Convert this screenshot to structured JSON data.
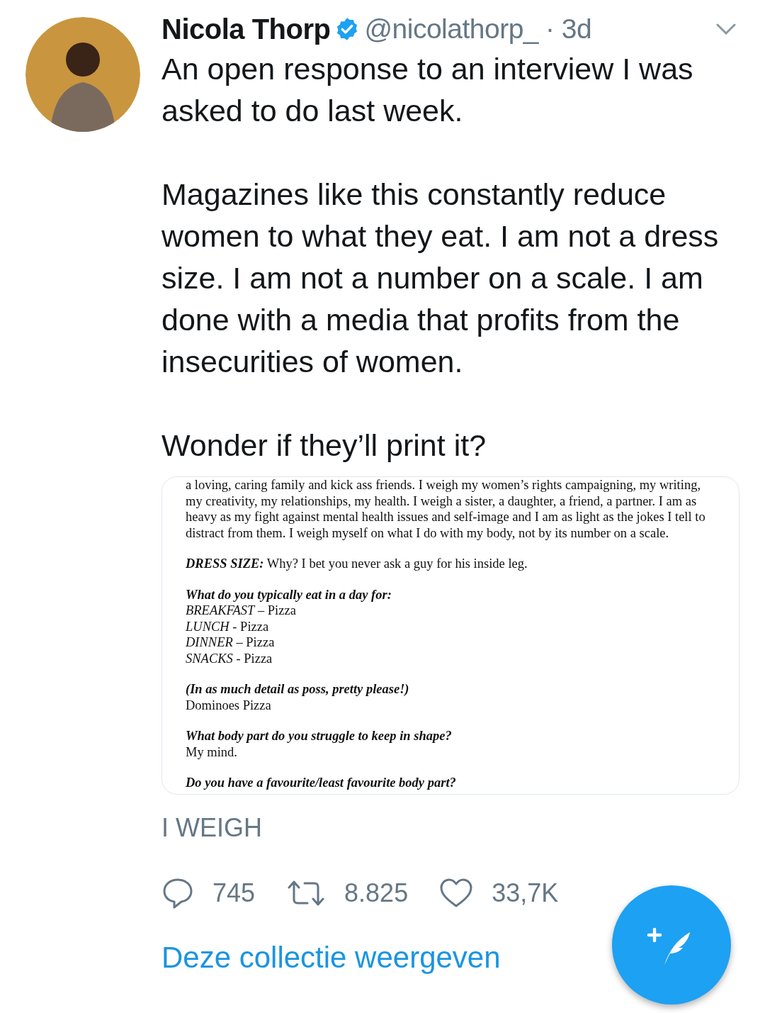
{
  "tweet": {
    "author": {
      "name": "Nicola Thorp",
      "verified": true,
      "handle": "@nicolathorp_",
      "time": "· 3d"
    },
    "paragraphs": [
      "An open response to an interview I was asked to do last week.",
      "Magazines like this constantly reduce women to what they eat. I am not a dress size. I am not a number on a scale. I am done with a media that profits from the insecurities of women.",
      "Wonder if they’ll print it?"
    ],
    "document": {
      "blocks": [
        {
          "lines": [
            {
              "kind": "plain",
              "text": "a loving, caring family and kick ass friends. I weigh my women’s rights campaigning, my writing, my creativity, my relationships, my health. I weigh a sister, a daughter, a friend, a partner. I am as heavy as my fight against mental health issues and self-image and I am as light as the jokes I tell to distract from them. I weigh myself on what I do with my body, not by its number on a scale."
            }
          ]
        },
        {
          "lines": [
            {
              "kind": "bold-label",
              "label": "DRESS SIZE:",
              "text": "Why? I bet you never ask a guy for his inside leg."
            }
          ]
        },
        {
          "lines": [
            {
              "kind": "question",
              "text": "What do you typically eat in a day for:"
            },
            {
              "kind": "italic-label",
              "label": "BREAKFAST",
              "text": "– Pizza"
            },
            {
              "kind": "italic-label",
              "label": "LUNCH",
              "text": "- Pizza"
            },
            {
              "kind": "italic-label",
              "label": "DINNER",
              "text": "– Pizza"
            },
            {
              "kind": "italic-label",
              "label": "SNACKS",
              "text": "- Pizza"
            }
          ]
        },
        {
          "lines": [
            {
              "kind": "question",
              "text": "(In as much detail as poss, pretty please!)"
            },
            {
              "kind": "plain",
              "text": "Dominoes Pizza"
            }
          ]
        },
        {
          "lines": [
            {
              "kind": "question",
              "text": "What body part do you struggle to keep in shape?"
            },
            {
              "kind": "plain",
              "text": "My mind."
            }
          ]
        },
        {
          "lines": [
            {
              "kind": "question",
              "text": "Do you have a favourite/least favourite body part?"
            }
          ]
        }
      ]
    },
    "caption": "I WEIGH",
    "actions": [
      {
        "kind": "reply",
        "count": "745"
      },
      {
        "kind": "retweet",
        "count": "8.825"
      },
      {
        "kind": "like",
        "count": "33,7K"
      }
    ],
    "collection_link": "Deze collectie weergeven"
  }
}
